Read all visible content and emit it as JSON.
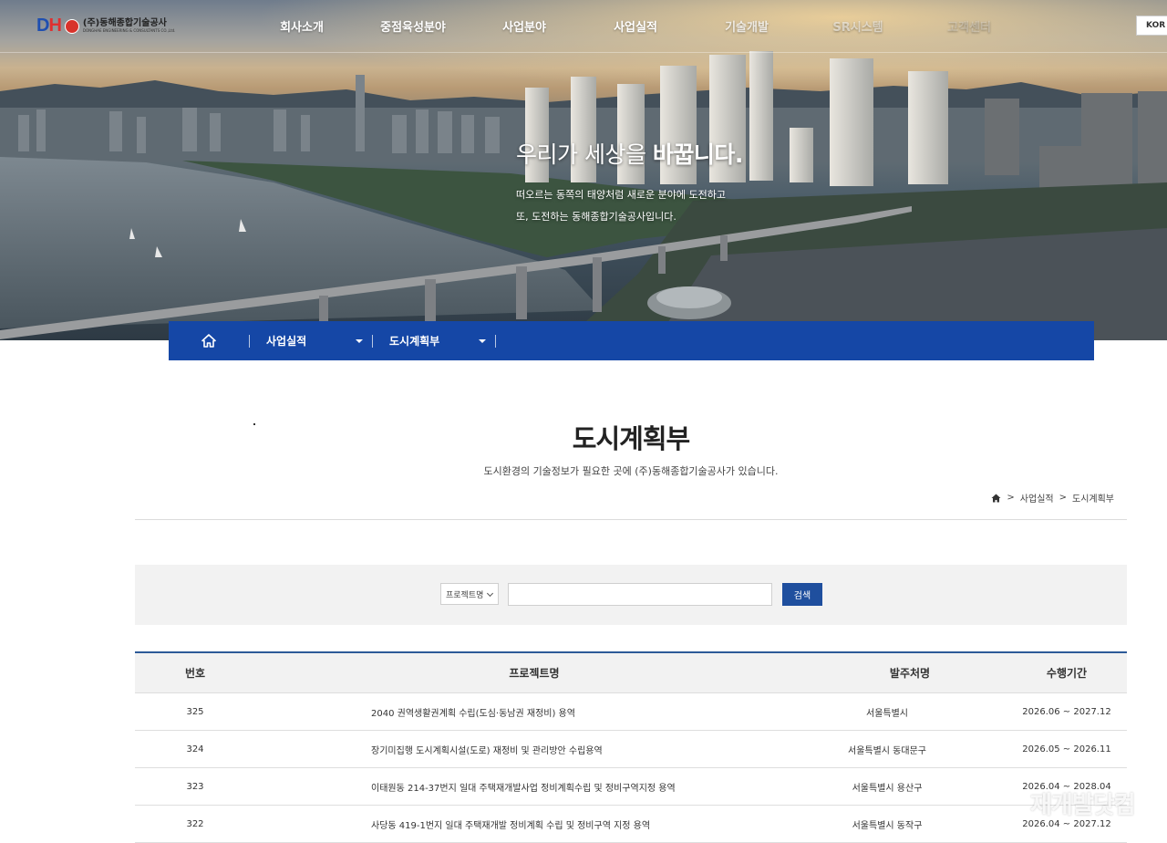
{
  "logo": {
    "mark": "DH",
    "name_kr": "(주)동해종합기술공사",
    "name_en": "DONGHAE ENGINEERING & CONSULTANTS CO.,Ltd."
  },
  "nav": {
    "items": [
      "회사소개",
      "중점육성분야",
      "사업분야",
      "사업실적",
      "기술개발",
      "SR시스템",
      "고객센터"
    ],
    "lang": "KOR"
  },
  "hero": {
    "headline_light": "우리가 세상을",
    "headline_bold": "바꿉니다.",
    "sub_line1": "떠오르는 동쪽의 태양처럼 새로운 분야에 도전하고",
    "sub_line2": "또, 도전하는 동해종합기술공사입니다."
  },
  "location": {
    "level1": "사업실적",
    "level2": "도시계획부"
  },
  "page": {
    "title": "도시계획부",
    "description": "도시환경의 기술정보가 필요한 곳에 (주)동해종합기술공사가 있습니다.",
    "breadcrumb": [
      "사업실적",
      "도시계획부"
    ],
    "breadcrumb_sep": ">"
  },
  "search": {
    "select_value": "프로젝트명",
    "input_value": "",
    "button_label": "검색"
  },
  "table": {
    "headers": [
      "번호",
      "프로젝트명",
      "발주처명",
      "수행기간"
    ],
    "rows": [
      {
        "num": "325",
        "name": "2040 권역생활권계획 수립(도심·동남권 재정비) 용역",
        "client": "서울특별시",
        "period": "2026.06 ~ 2027.12"
      },
      {
        "num": "324",
        "name": "장기미집행 도시계획시설(도로) 재정비 및 관리방안 수립용역",
        "client": "서울특별시 동대문구",
        "period": "2026.05 ~ 2026.11"
      },
      {
        "num": "323",
        "name": "이태원동 214-37번지 일대 주택재개발사업 정비계획수립 및 정비구역지정 용역",
        "client": "서울특별시 용산구",
        "period": "2026.04 ~ 2028.04"
      },
      {
        "num": "322",
        "name": "사당동 419-1번지 일대 주택재개발 정비계획 수립 및 정비구역 지정 용역",
        "client": "서울특별시 동작구",
        "period": "2026.04 ~ 2027.12"
      }
    ]
  },
  "watermark": "재개발닷컴",
  "colors": {
    "location_bar": "#1547a6",
    "search_button": "#1f4f9e",
    "table_top_border": "#2d5a98"
  }
}
